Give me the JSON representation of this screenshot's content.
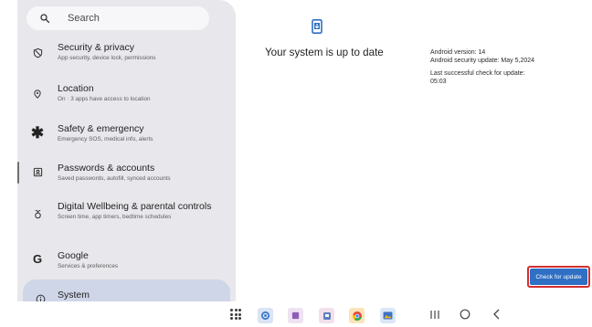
{
  "search": {
    "label": "Search",
    "icon": "search-icon"
  },
  "sidebar": {
    "items": [
      {
        "title": "Security & privacy",
        "subtitle": "App security, device lock, permissions",
        "icon": "shield-icon"
      },
      {
        "title": "Location",
        "subtitle": "On · 3 apps have access to location",
        "icon": "location-pin-icon"
      },
      {
        "title": "Safety & emergency",
        "subtitle": "Emergency SOS, medical info, alerts",
        "icon": "asterisk-icon"
      },
      {
        "title": "Passwords & accounts",
        "subtitle": "Saved passwords, autofill, synced accounts",
        "icon": "account-box-icon"
      },
      {
        "title": "Digital Wellbeing & parental controls",
        "subtitle": "Screen time, app timers, bedtime schedules",
        "icon": "wellbeing-icon"
      },
      {
        "title": "Google",
        "subtitle": "Services & preferences",
        "icon": "google-icon"
      },
      {
        "title": "System",
        "subtitle": "",
        "icon": "info-icon",
        "selected": true
      }
    ]
  },
  "main": {
    "status_title": "Your system is up to date",
    "android_version": "Android version: 14",
    "security_update": "Android security update: May 5,2024",
    "last_check_label": "Last successful check for update:",
    "last_check_time": "05:03",
    "check_button": "Check for update"
  },
  "taskbar": {
    "apps": [
      "settings-app-icon",
      "purple-app-icon",
      "pink-app-icon",
      "chrome-icon",
      "photos-app-icon"
    ],
    "nav": [
      "recents-icon",
      "home-icon",
      "back-icon"
    ]
  },
  "colors": {
    "accent": "#2f6fc4",
    "highlight": "#d32f2f",
    "panel": "#e8e8ec",
    "selected": "#cfd6e8"
  }
}
